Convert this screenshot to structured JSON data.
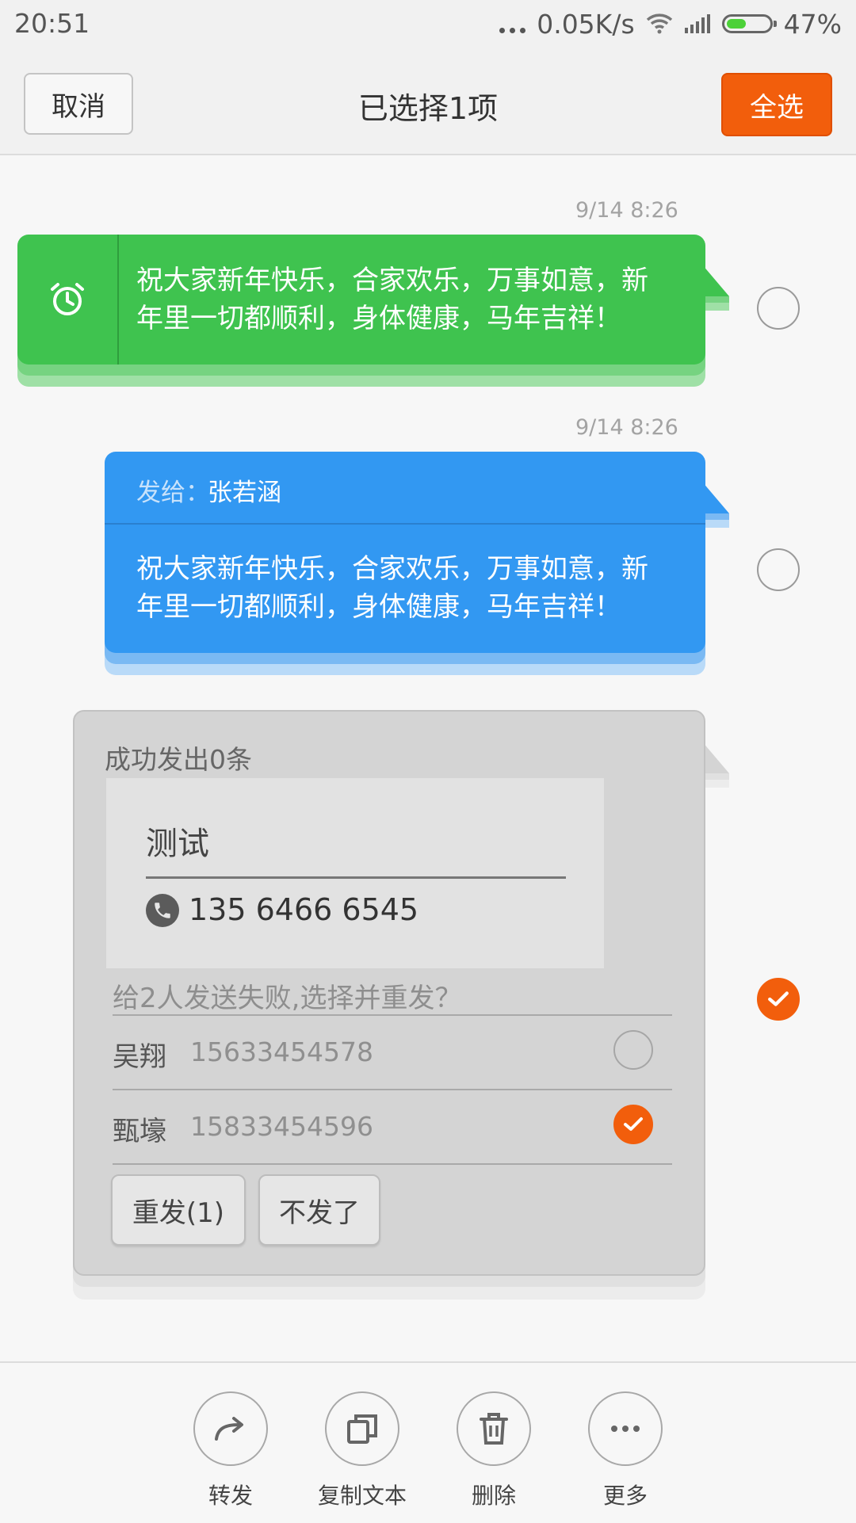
{
  "status_bar": {
    "time": "20:51",
    "network_speed": "0.05K/s",
    "battery_percent": "47%",
    "battery_level": 0.47,
    "icons": [
      "more-dots-icon",
      "wifi-icon",
      "signal-icon",
      "battery-icon"
    ]
  },
  "header": {
    "cancel_label": "取消",
    "title": "已选择1项",
    "select_all_label": "全选"
  },
  "messages": [
    {
      "time": "9/14 8:26",
      "type": "scheduled",
      "icon": "alarm-clock-icon",
      "text_line1": "祝大家新年快乐，合家欢乐，万事如意，新",
      "text_line2": "年里一切都顺利，身体健康，马年吉祥！",
      "selected": false,
      "color": "#3fc34f"
    },
    {
      "time": "9/14 8:26",
      "type": "sent",
      "to_label": "发给：",
      "to_name": "张若涵",
      "text_line1": "祝大家新年快乐，合家欢乐，万事如意，新",
      "text_line2": "年里一切都顺利，身体健康，马年吉祥！",
      "selected": false,
      "color": "#3298f2"
    },
    {
      "type": "failed",
      "title": "成功发出0条",
      "contact_card": {
        "name": "测试",
        "phone": "135 6466 6545",
        "icon": "phone-icon"
      },
      "fail_prompt": "给2人发送失败,选择并重发？",
      "recipients": [
        {
          "name": "吴翔",
          "number": "15633454578",
          "checked": false
        },
        {
          "name": "甄壕",
          "number": "15833454596",
          "checked": true
        }
      ],
      "resend_label": "重发(1)",
      "dont_send_label": "不发了",
      "selected": true
    }
  ],
  "bottom_actions": [
    {
      "label": "转发",
      "icon": "forward-icon"
    },
    {
      "label": "复制文本",
      "icon": "copy-icon"
    },
    {
      "label": "删除",
      "icon": "trash-icon"
    },
    {
      "label": "更多",
      "icon": "more-icon"
    }
  ],
  "colors": {
    "accent": "#f25e0c",
    "green_bubble": "#3fc34f",
    "blue_bubble": "#3298f2",
    "grey_bubble": "#d4d4d4"
  }
}
